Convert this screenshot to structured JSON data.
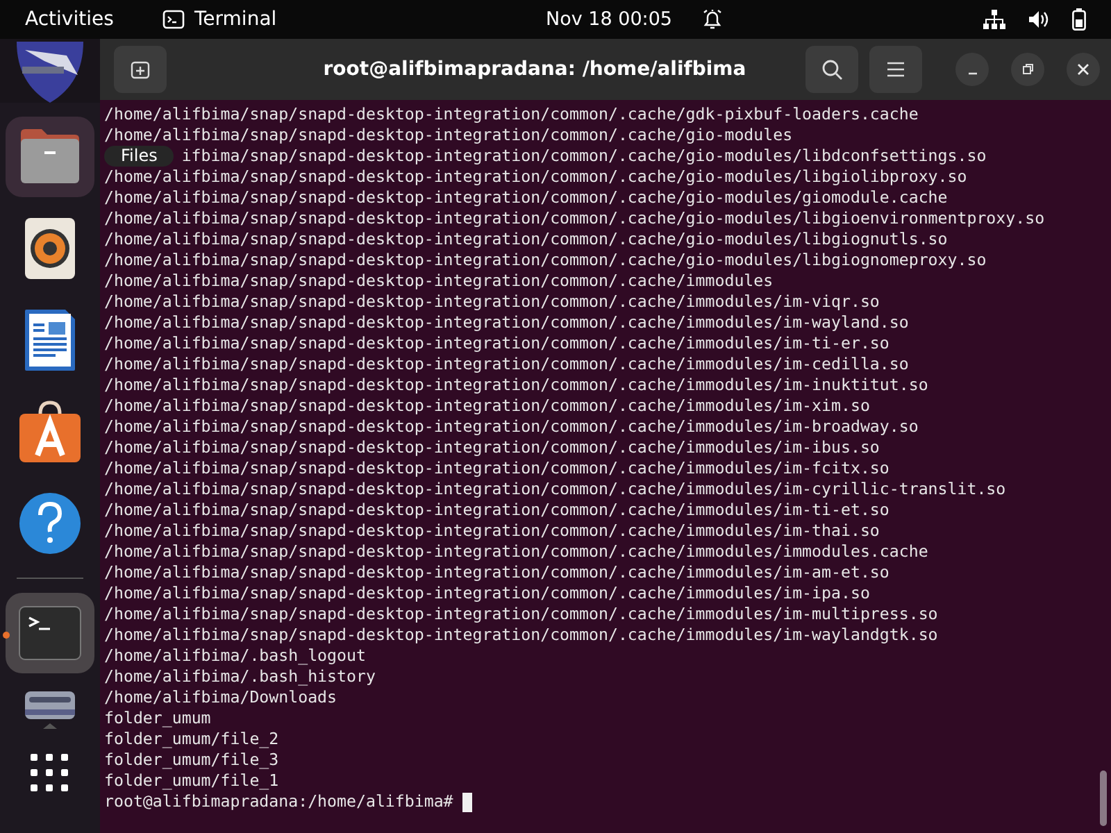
{
  "top_bar": {
    "activities": "Activities",
    "app_name": "Terminal",
    "clock": "Nov 18  00:05"
  },
  "dock": {
    "items": [
      {
        "kind": "partial",
        "highlighted": false,
        "running": false
      },
      {
        "kind": "files",
        "highlighted": true,
        "running": false
      },
      {
        "kind": "music",
        "highlighted": false,
        "running": false
      },
      {
        "kind": "writer",
        "highlighted": false,
        "running": false
      },
      {
        "kind": "store",
        "highlighted": false,
        "running": false
      },
      {
        "kind": "help",
        "highlighted": false,
        "running": false
      },
      {
        "kind": "separator"
      },
      {
        "kind": "terminal",
        "highlighted": true,
        "running": true
      },
      {
        "kind": "drive",
        "highlighted": false,
        "running": false
      },
      {
        "kind": "apps",
        "highlighted": false,
        "running": false
      }
    ],
    "tooltip": "Files"
  },
  "terminal": {
    "title": "root@alifbimapradana: /home/alifbima",
    "lines": [
      {
        "text": "/home/alifbima/snap/snapd-desktop-integration/common/.cache/gdk-pixbuf-loaders.cache",
        "covered": false
      },
      {
        "text": "/home/alifbima/snap/snapd-desktop-integration/common/.cache/gio-modules",
        "covered": false
      },
      {
        "text": "ifbima/snap/snapd-desktop-integration/common/.cache/gio-modules/libdconfsettings.so",
        "covered": true
      },
      {
        "text": "/home/alifbima/snap/snapd-desktop-integration/common/.cache/gio-modules/libgiolibproxy.so",
        "covered": false
      },
      {
        "text": "/home/alifbima/snap/snapd-desktop-integration/common/.cache/gio-modules/giomodule.cache",
        "covered": false
      },
      {
        "text": "/home/alifbima/snap/snapd-desktop-integration/common/.cache/gio-modules/libgioenvironmentproxy.so",
        "covered": false
      },
      {
        "text": "/home/alifbima/snap/snapd-desktop-integration/common/.cache/gio-modules/libgiognutls.so",
        "covered": false
      },
      {
        "text": "/home/alifbima/snap/snapd-desktop-integration/common/.cache/gio-modules/libgiognomeproxy.so",
        "covered": false
      },
      {
        "text": "/home/alifbima/snap/snapd-desktop-integration/common/.cache/immodules",
        "covered": false
      },
      {
        "text": "/home/alifbima/snap/snapd-desktop-integration/common/.cache/immodules/im-viqr.so",
        "covered": false
      },
      {
        "text": "/home/alifbima/snap/snapd-desktop-integration/common/.cache/immodules/im-wayland.so",
        "covered": false
      },
      {
        "text": "/home/alifbima/snap/snapd-desktop-integration/common/.cache/immodules/im-ti-er.so",
        "covered": false
      },
      {
        "text": "/home/alifbima/snap/snapd-desktop-integration/common/.cache/immodules/im-cedilla.so",
        "covered": false
      },
      {
        "text": "/home/alifbima/snap/snapd-desktop-integration/common/.cache/immodules/im-inuktitut.so",
        "covered": false
      },
      {
        "text": "/home/alifbima/snap/snapd-desktop-integration/common/.cache/immodules/im-xim.so",
        "covered": false
      },
      {
        "text": "/home/alifbima/snap/snapd-desktop-integration/common/.cache/immodules/im-broadway.so",
        "covered": false
      },
      {
        "text": "/home/alifbima/snap/snapd-desktop-integration/common/.cache/immodules/im-ibus.so",
        "covered": false
      },
      {
        "text": "/home/alifbima/snap/snapd-desktop-integration/common/.cache/immodules/im-fcitx.so",
        "covered": false
      },
      {
        "text": "/home/alifbima/snap/snapd-desktop-integration/common/.cache/immodules/im-cyrillic-translit.so",
        "covered": false
      },
      {
        "text": "/home/alifbima/snap/snapd-desktop-integration/common/.cache/immodules/im-ti-et.so",
        "covered": false
      },
      {
        "text": "/home/alifbima/snap/snapd-desktop-integration/common/.cache/immodules/im-thai.so",
        "covered": false
      },
      {
        "text": "/home/alifbima/snap/snapd-desktop-integration/common/.cache/immodules/immodules.cache",
        "covered": false
      },
      {
        "text": "/home/alifbima/snap/snapd-desktop-integration/common/.cache/immodules/im-am-et.so",
        "covered": false
      },
      {
        "text": "/home/alifbima/snap/snapd-desktop-integration/common/.cache/immodules/im-ipa.so",
        "covered": false
      },
      {
        "text": "/home/alifbima/snap/snapd-desktop-integration/common/.cache/immodules/im-multipress.so",
        "covered": false
      },
      {
        "text": "/home/alifbima/snap/snapd-desktop-integration/common/.cache/immodules/im-waylandgtk.so",
        "covered": false
      },
      {
        "text": "/home/alifbima/.bash_logout",
        "covered": false
      },
      {
        "text": "/home/alifbima/.bash_history",
        "covered": false
      },
      {
        "text": "/home/alifbima/Downloads",
        "covered": false
      },
      {
        "text": "folder_umum",
        "covered": false
      },
      {
        "text": "folder_umum/file_2",
        "covered": false
      },
      {
        "text": "folder_umum/file_3",
        "covered": false
      },
      {
        "text": "folder_umum/file_1",
        "covered": false
      }
    ],
    "prompt": "root@alifbimapradana:/home/alifbima#"
  }
}
